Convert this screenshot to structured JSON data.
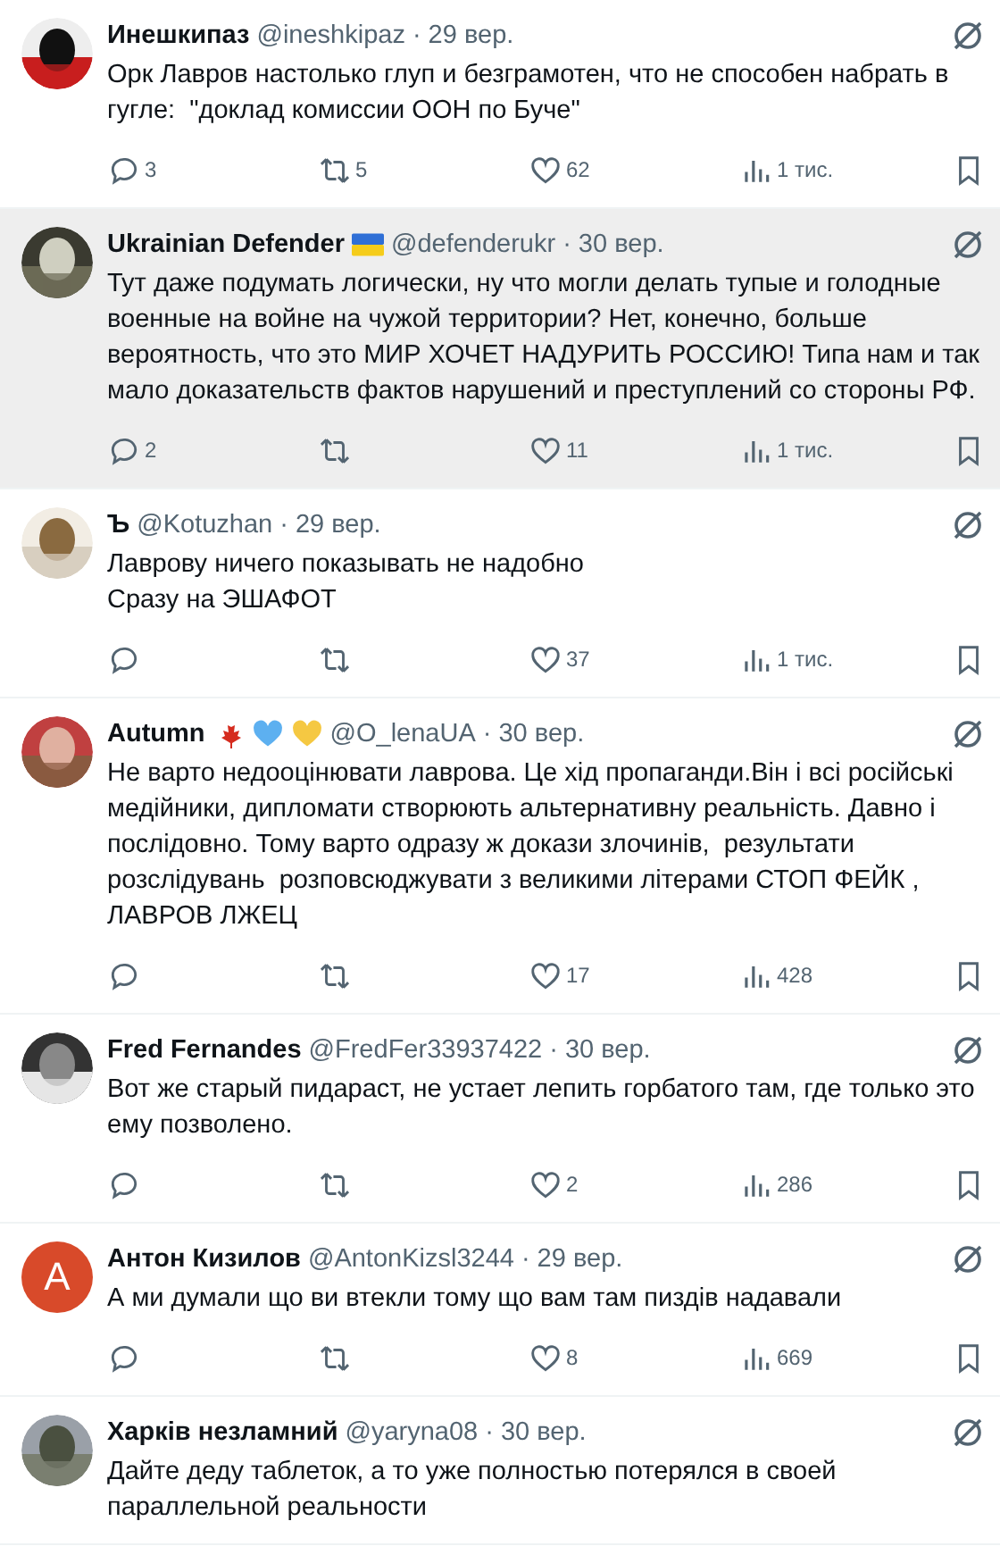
{
  "tweets": [
    {
      "name": "Инешкипаз",
      "handle": "@ineshkipaz",
      "date": "· 29 вер.",
      "highlighted": false,
      "text": "Орк Лавров настолько глуп и безграмотен, что не способен набрать в гугле:  \"доклад комиссии ООН по Буче\"",
      "actions": [
        {
          "kind": "reply",
          "count": "3"
        },
        {
          "kind": "retweet",
          "count": "5"
        },
        {
          "kind": "like",
          "count": "62"
        },
        {
          "kind": "views",
          "count": "1 тис."
        },
        {
          "kind": "bookmark"
        }
      ]
    },
    {
      "name": "Ukrainian Defender",
      "badges": [
        {
          "kind": "flag"
        }
      ],
      "handle": "@defenderukr",
      "date": "· 30 вер.",
      "highlighted": true,
      "text": "Тут даже подумать логически, ну что могли делать тупые и голодные военные на войне на чужой территории? Нет, конечно, больше вероятность, что это МИР ХОЧЕТ НАДУРИТЬ РОССИЮ! Типа нам и так мало доказательств фактов нарушений и преступлений со стороны РФ.",
      "actions": [
        {
          "kind": "reply",
          "count": "2"
        },
        {
          "kind": "retweet"
        },
        {
          "kind": "like",
          "count": "11"
        },
        {
          "kind": "views",
          "count": "1 тис."
        },
        {
          "kind": "bookmark"
        }
      ]
    },
    {
      "name": "Ъ",
      "handle": "@Kotuzhan",
      "date": "· 29 вер.",
      "highlighted": false,
      "text": "Лаврову ничего показывать не надобно\nСразу на ЭШАФОТ",
      "actions": [
        {
          "kind": "reply"
        },
        {
          "kind": "retweet"
        },
        {
          "kind": "like",
          "count": "37"
        },
        {
          "kind": "views",
          "count": "1 тис."
        },
        {
          "kind": "bookmark"
        }
      ]
    },
    {
      "name": "Autumn",
      "badges": [
        {
          "kind": "maple-leaf"
        },
        {
          "kind": "blue-heart"
        },
        {
          "kind": "yellow-heart"
        }
      ],
      "handle": "@O_lenaUA",
      "date": "· 30 вер.",
      "highlighted": false,
      "text": "Не варто недооцінювати лаврова. Це хід пропаганди.Він і всі російські медійники, дипломати створюють альтернативну реальність. Давно і послідовно. Тому варто одразу ж докази злочинів,  результати розслідувань  розповсюджувати з великими літерами СТОП ФЕЙК , ЛАВРОВ ЛЖЕЦ",
      "actions": [
        {
          "kind": "reply"
        },
        {
          "kind": "retweet"
        },
        {
          "kind": "like",
          "count": "17"
        },
        {
          "kind": "views",
          "count": "428"
        },
        {
          "kind": "bookmark"
        }
      ]
    },
    {
      "name": "Fred Fernandes",
      "handle": "@FredFer33937422",
      "date": "· 30 вер.",
      "highlighted": false,
      "text": "Вот же старый пидараст, не устает лепить горбатого там, где только это ему позволено.",
      "actions": [
        {
          "kind": "reply"
        },
        {
          "kind": "retweet"
        },
        {
          "kind": "like",
          "count": "2"
        },
        {
          "kind": "views",
          "count": "286"
        },
        {
          "kind": "bookmark"
        }
      ]
    },
    {
      "avatar": {
        "kind": "letter",
        "letter": "A",
        "color": "#d84a2a"
      },
      "name": "Антон Кизилов",
      "handle": "@AntonKizsl3244",
      "date": "· 29 вер.",
      "highlighted": false,
      "text": "А ми думали що ви втекли тому що вам там пиздів надавали",
      "actions": [
        {
          "kind": "reply"
        },
        {
          "kind": "retweet"
        },
        {
          "kind": "like",
          "count": "8"
        },
        {
          "kind": "views",
          "count": "669"
        },
        {
          "kind": "bookmark"
        }
      ]
    },
    {
      "name": "Харків незламний",
      "handle": "@yaryna08",
      "date": "· 30 вер.",
      "highlighted": false,
      "text": "Дайте деду таблеток, а то уже полностью потерялся в своей параллельной реальности"
    }
  ]
}
